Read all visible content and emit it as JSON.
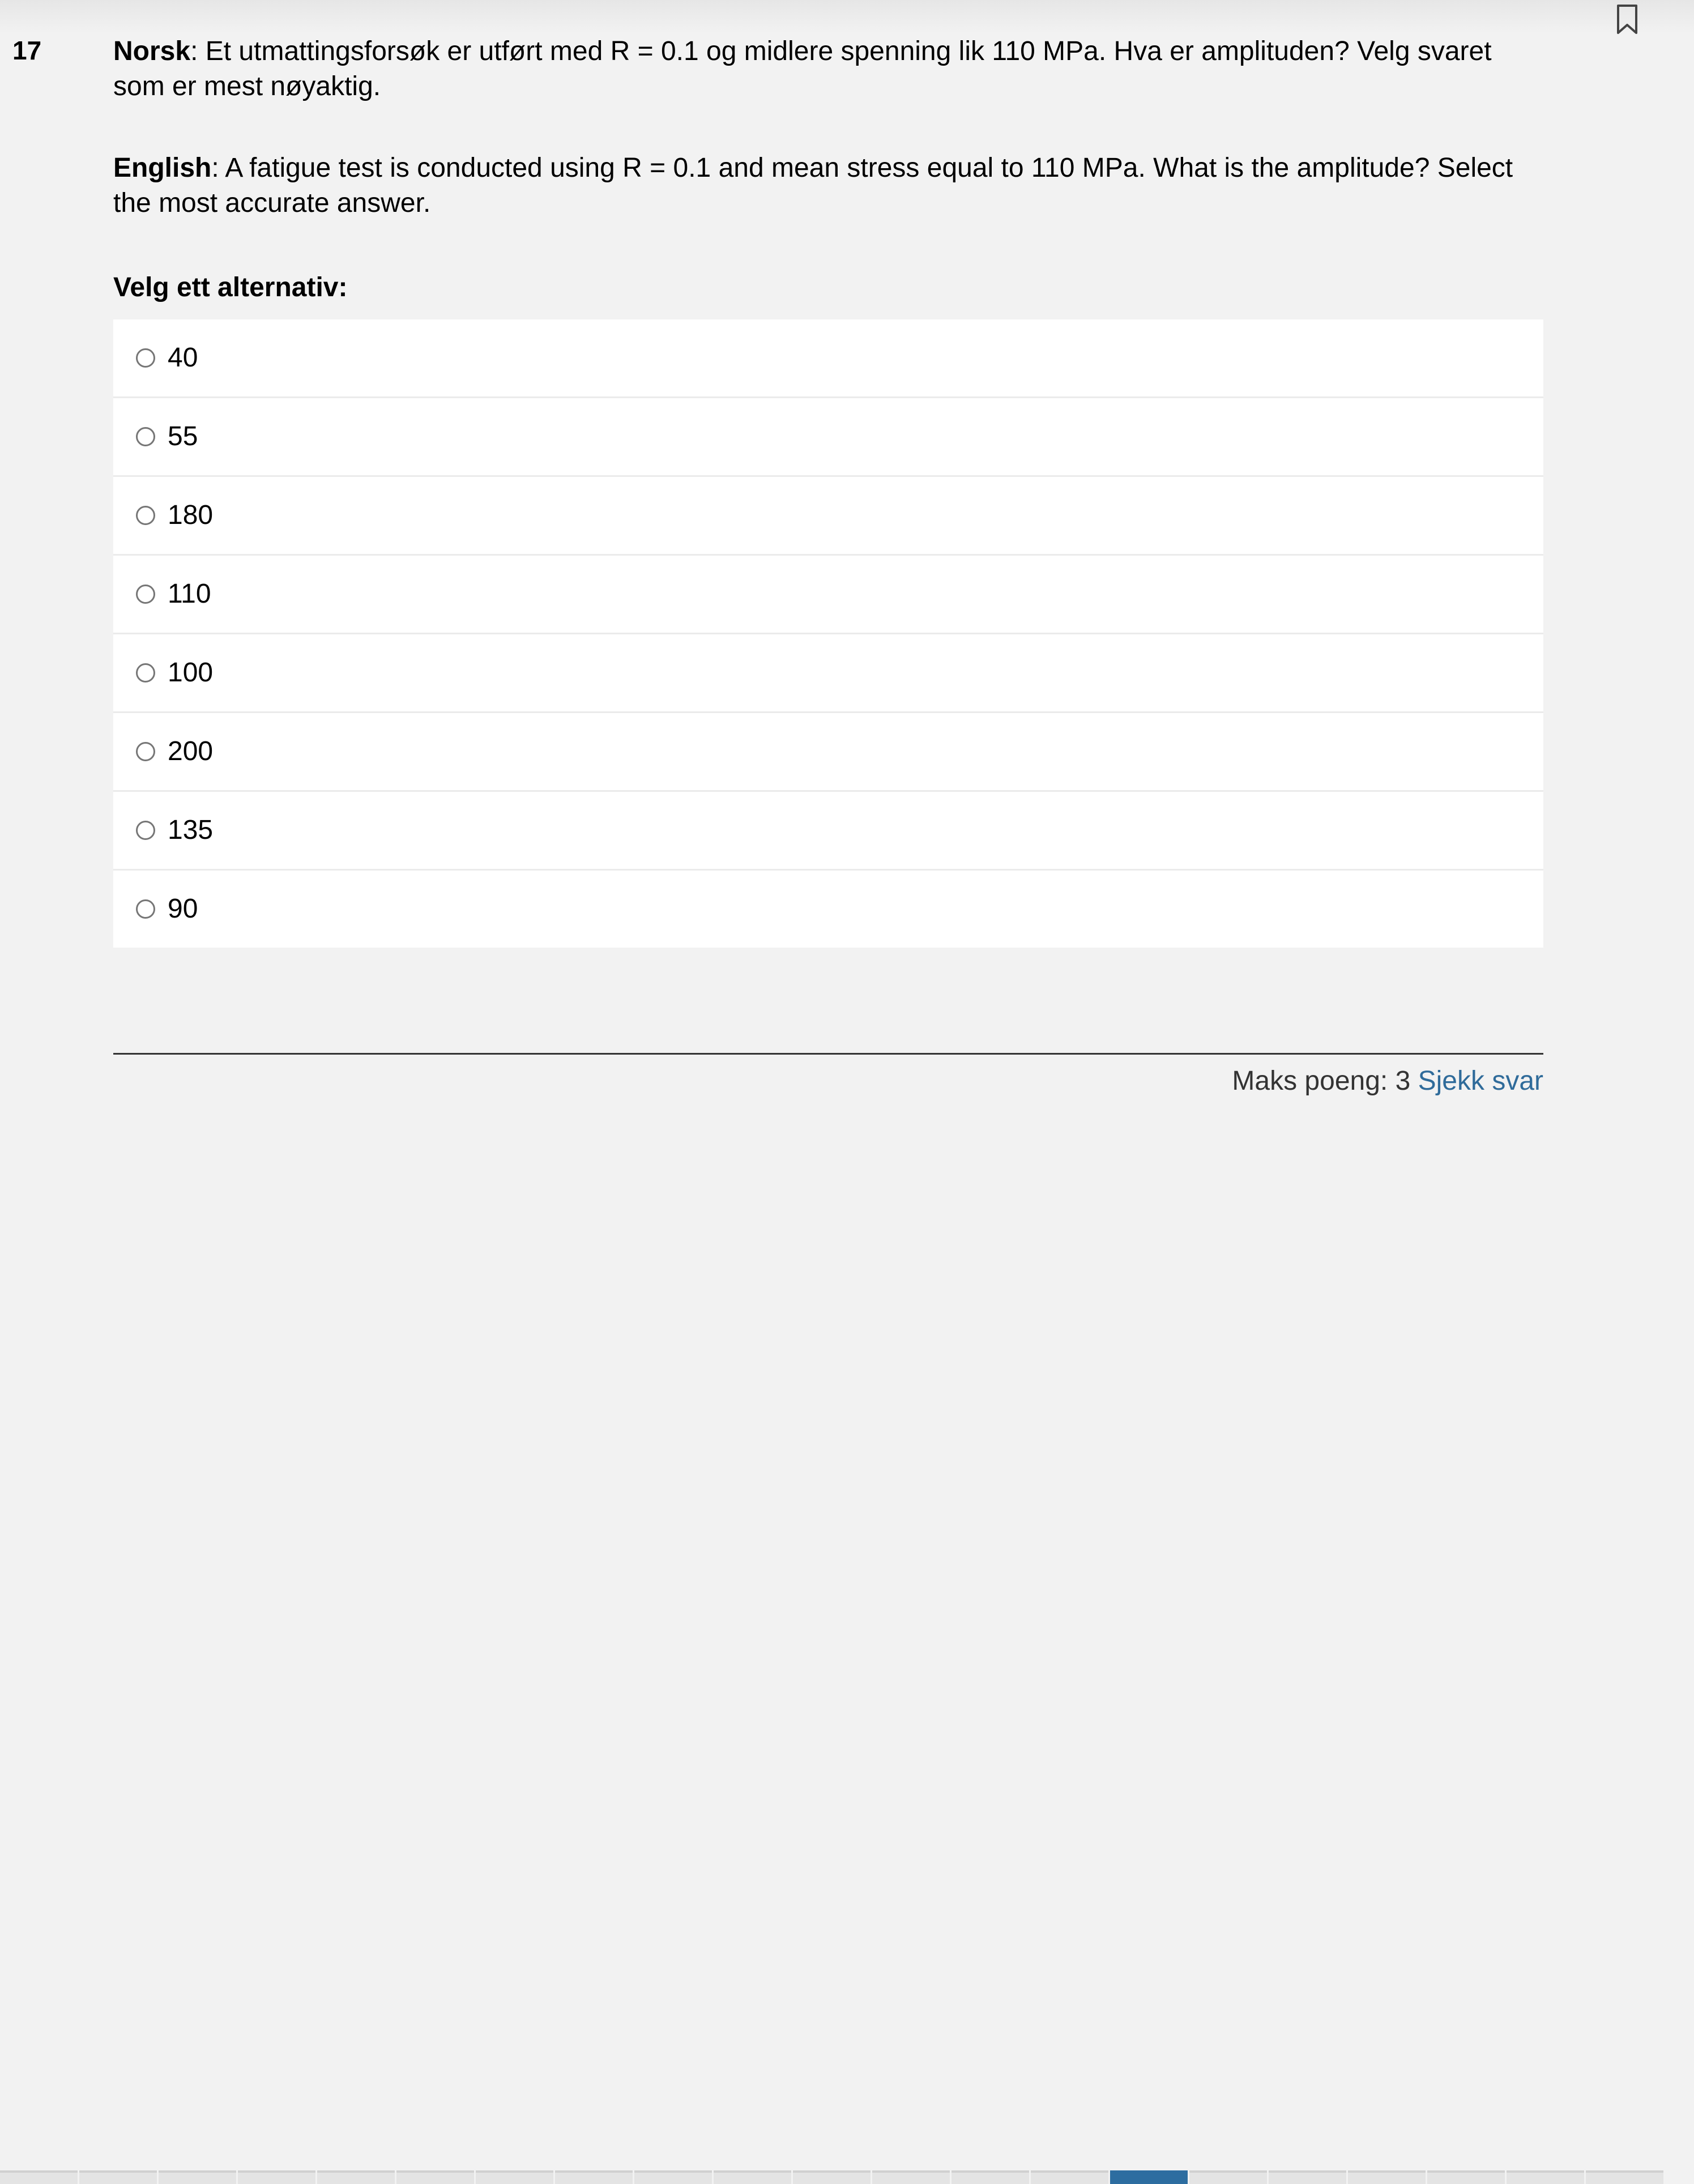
{
  "question": {
    "number": "17",
    "norsk_label": "Norsk",
    "norsk_text": ": Et utmattingsforsøk er utført med R = 0.1 og midlere spenning lik 110 MPa. Hva er amplituden? Velg svaret som er mest nøyaktig.",
    "english_label": "English",
    "english_text": ": A fatigue test is conducted using R = 0.1 and mean stress equal to 110 MPa. What is the amplitude? Select the most accurate answer.",
    "choose_label": "Velg ett alternativ:"
  },
  "options": [
    "40",
    "55",
    "180",
    "110",
    "100",
    "200",
    "135",
    "90"
  ],
  "footer": {
    "max_points": "Maks poeng: 3",
    "check_answer": "Sjekk svar"
  },
  "icons": {
    "bookmark": "bookmark-icon"
  },
  "colors": {
    "background": "#f2f2f2",
    "link": "#2f6b9a",
    "active_nav": "#2d6da0"
  }
}
